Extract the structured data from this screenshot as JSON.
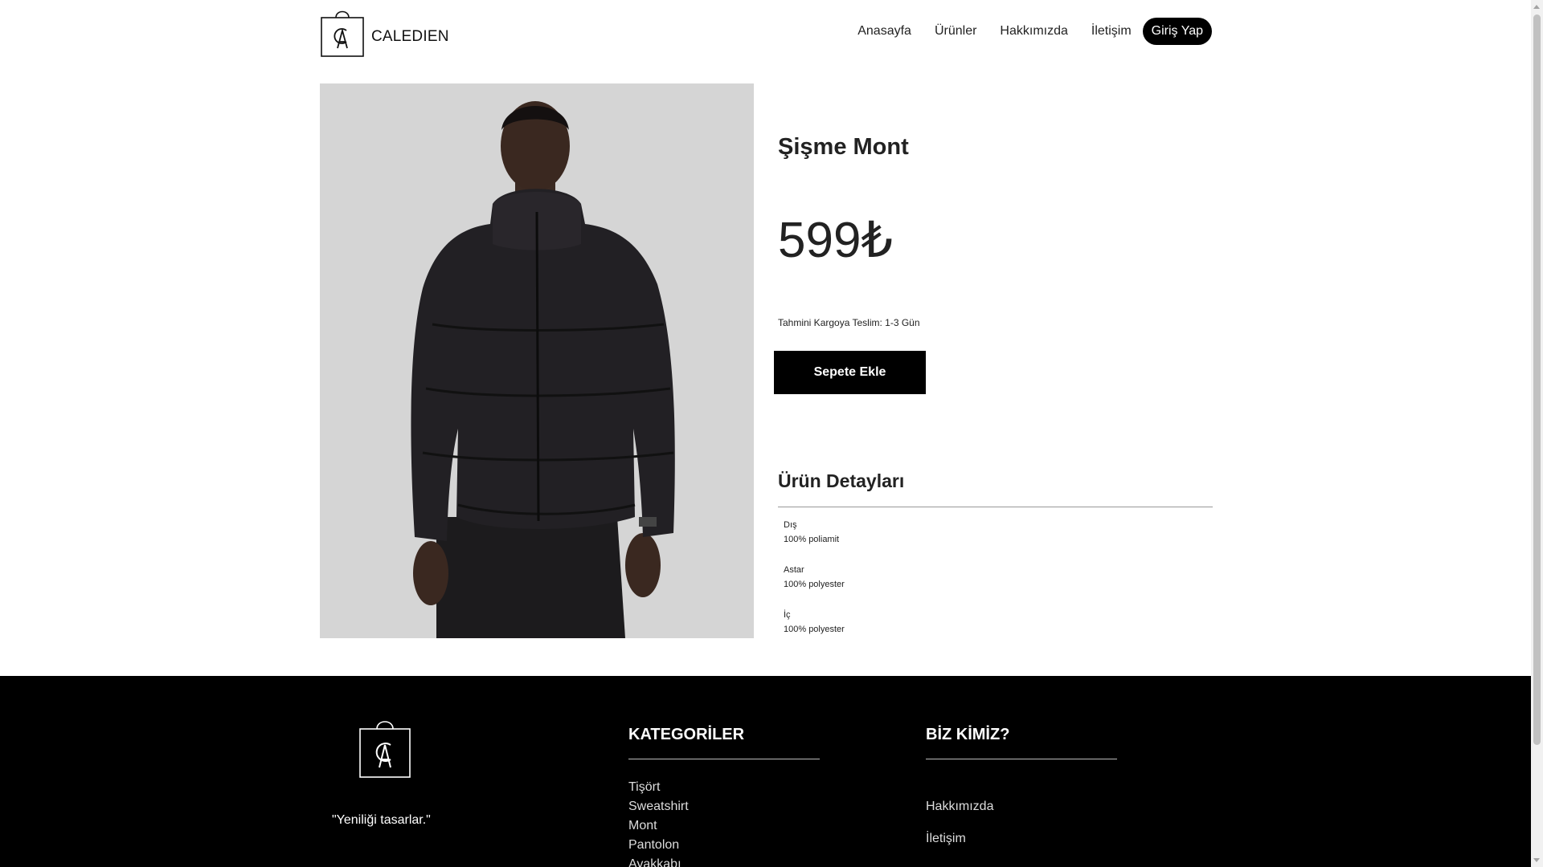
{
  "header": {
    "brand": "CALEDIEN",
    "nav": [
      "Anasayfa",
      "Ürünler",
      "Hakkımızda",
      "İletişim"
    ],
    "login_label": "Giriş Yap"
  },
  "product": {
    "title": "Şişme Mont",
    "price": "599₺",
    "delivery": "Tahmini Kargoya Teslim: 1-3 Gün",
    "add_to_cart": "Sepete Ekle",
    "details_title": "Ürün Detayları",
    "details": [
      {
        "label": "Dış",
        "value": "100% poliamit"
      },
      {
        "label": "Astar",
        "value": "100% polyester"
      },
      {
        "label": "İç",
        "value": "100% polyester"
      }
    ]
  },
  "footer": {
    "slogan": "\"Yeniliği tasarlar.\"",
    "categories_title": "KATEGORİLER",
    "categories": [
      "Tişört",
      "Sweatshirt",
      "Mont",
      "Pantolon",
      "Ayakkabı"
    ],
    "about_title": "BİZ KİMİZ?",
    "about_links": [
      "Hakkımızda",
      "İletişim"
    ]
  }
}
